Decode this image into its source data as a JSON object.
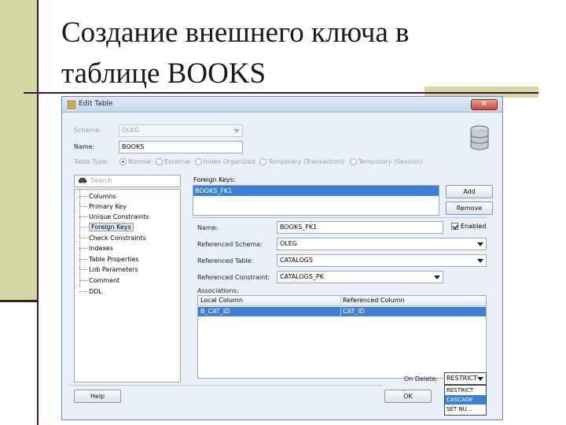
{
  "slide": {
    "title_line1": "Создание внешнего ключа в",
    "title_line2": "таблице BOOKS"
  },
  "window": {
    "title": "Edit Table",
    "close_glyph": "✕"
  },
  "form": {
    "schema_label": "Schema:",
    "schema_value": "OLEG",
    "name_label": "Name:",
    "name_value": "BOOKS",
    "table_type_label": "Table Type:",
    "table_types": [
      "Normal",
      "External",
      "Index Organized",
      "Temporary (Transaction)",
      "Temporary (Session)"
    ]
  },
  "search": {
    "placeholder": "Search"
  },
  "nav": {
    "items": [
      "Columns",
      "Primary Key",
      "Unique Constraints",
      "Foreign Keys",
      "Check Constraints",
      "Indexes",
      "Table Properties",
      "Lob Parameters",
      "Comment",
      "DDL"
    ],
    "selected": "Foreign Keys"
  },
  "foreign_keys": {
    "label": "Foreign Keys:",
    "items": [
      "BOOKS_FK1"
    ],
    "add_label": "Add",
    "remove_label": "Remove"
  },
  "fk_detail": {
    "name_label": "Name:",
    "name_value": "BOOKS_FK1",
    "enabled_label": "Enabled",
    "enabled": true,
    "ref_schema_label": "Referenced Schema:",
    "ref_schema_value": "OLEG",
    "ref_table_label": "Referenced Table:",
    "ref_table_value": "CATALOGS",
    "ref_constraint_label": "Referenced Constraint:",
    "ref_constraint_value": "CATALOGS_PK",
    "associations_label": "Associations:",
    "assoc_headers": [
      "Local Column",
      "Referenced Column"
    ],
    "assoc_rows": [
      [
        "B_CAT_ID",
        "CAT_ID"
      ]
    ],
    "on_delete_label": "On Delete:",
    "on_delete_value": "RESTRICT",
    "on_delete_options": [
      "RESTRICT",
      "CASCADE",
      "SET NU..."
    ],
    "on_delete_highlighted": "CASCADE"
  },
  "footer": {
    "help_label": "Help",
    "ok_label": "OK"
  },
  "colors": {
    "selection": "#3d7fd6",
    "window_bg": "#eaf0f7",
    "slide_band": "#d4d8a4",
    "slide_rule": "#4a1535"
  }
}
